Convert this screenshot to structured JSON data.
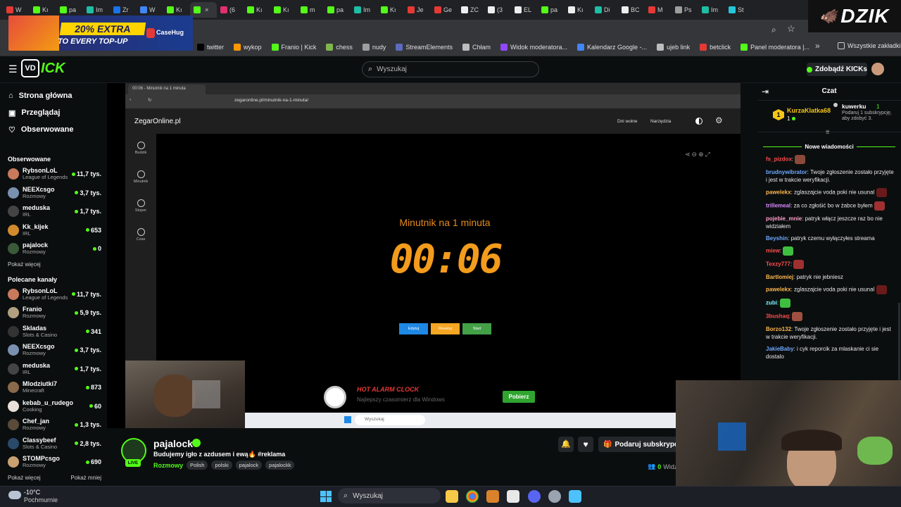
{
  "browser": {
    "tabs": [
      {
        "label": "W",
        "color": "#e53935"
      },
      {
        "label": "Kı",
        "color": "#53fc18"
      },
      {
        "label": "pa",
        "color": "#53fc18"
      },
      {
        "label": "Im",
        "color": "#1ebea5"
      },
      {
        "label": "Zr",
        "color": "#1a73e8"
      },
      {
        "label": "W",
        "color": "#4285f4"
      },
      {
        "label": "Kı",
        "color": "#53fc18"
      },
      {
        "label": "",
        "color": "#53fc18",
        "active": true
      },
      {
        "label": "(6",
        "color": "#e1306c"
      },
      {
        "label": "Kı",
        "color": "#53fc18"
      },
      {
        "label": "Kı",
        "color": "#53fc18"
      },
      {
        "label": "m",
        "color": "#53fc18"
      },
      {
        "label": "pa",
        "color": "#53fc18"
      },
      {
        "label": "Im",
        "color": "#1ebea5"
      },
      {
        "label": "Kı",
        "color": "#53fc18"
      },
      {
        "label": "Je",
        "color": "#e53935"
      },
      {
        "label": "Ge",
        "color": "#e53935"
      },
      {
        "label": "ZC",
        "color": "#eeeeee"
      },
      {
        "label": "(3",
        "color": "#eeeeee"
      },
      {
        "label": "EL",
        "color": "#eeeeee"
      },
      {
        "label": "pa",
        "color": "#53fc18"
      },
      {
        "label": "Kı",
        "color": "#eeeeee"
      },
      {
        "label": "Di",
        "color": "#1ebea5"
      },
      {
        "label": "BC",
        "color": "#eeeeee"
      },
      {
        "label": "M",
        "color": "#e53935"
      },
      {
        "label": "Ps",
        "color": "#9e9e9e"
      },
      {
        "label": "Im",
        "color": "#1ebea5"
      },
      {
        "label": "St",
        "color": "#26c6da"
      }
    ],
    "bookmarks": [
      {
        "label": "twitter",
        "color": "#000000"
      },
      {
        "label": "wykop",
        "color": "#ff9800"
      },
      {
        "label": "Franio | Kick",
        "color": "#53fc18"
      },
      {
        "label": "chess",
        "color": "#81b64c"
      },
      {
        "label": "nudy",
        "color": "#9e9e9e"
      },
      {
        "label": "StreamElements",
        "color": "#5c6bc0"
      },
      {
        "label": "Chłam",
        "color": "#bdbdbd"
      },
      {
        "label": "Widok moderatora...",
        "color": "#9147ff"
      },
      {
        "label": "Kalendarz Google -...",
        "color": "#4285f4"
      },
      {
        "label": "ujeb link",
        "color": "#bdbdbd"
      },
      {
        "label": "betclick",
        "color": "#e53935"
      },
      {
        "label": "Panel moderatora |...",
        "color": "#53fc18"
      }
    ],
    "all_bookmarks": "Wszystkie zakładki"
  },
  "ad": {
    "promo": "20% EXTRA",
    "sub": "TO EVERY TOP-UP",
    "brand": "CaseHug"
  },
  "overlay_logo": "DZIK",
  "kick": {
    "search_placeholder": "Wyszukaj",
    "kicks_button": "Zdobądź KICKs",
    "nav": [
      "Strona główna",
      "Przeglądaj",
      "Obserwowane"
    ],
    "followed_title": "Obserwowane",
    "followed": [
      {
        "name": "RybsonLoL",
        "category": "League of Legends",
        "viewers": "11,7 tys.",
        "color": "#c97a5c"
      },
      {
        "name": "NEEXcsgo",
        "category": "Rozmowy",
        "viewers": "3,7 tys.",
        "color": "#7a90b0"
      },
      {
        "name": "meduska",
        "category": "IRL",
        "viewers": "1,7 tys.",
        "color": "#444"
      },
      {
        "name": "Kk_kijek",
        "category": "IRL",
        "viewers": "653",
        "color": "#d18b2c"
      },
      {
        "name": "pajalock",
        "category": "Rozmowy",
        "viewers": "0",
        "color": "#3a5a3a"
      }
    ],
    "show_more": "Pokaż więcej",
    "recommended_title": "Polecane kanały",
    "recommended": [
      {
        "name": "RybsonLoL",
        "category": "League of Legends",
        "viewers": "11,7 tys.",
        "color": "#c97a5c"
      },
      {
        "name": "Franio",
        "category": "Rozmowy",
        "viewers": "5,9 tys.",
        "color": "#b0a080"
      },
      {
        "name": "Skladas",
        "category": "Slots & Casino",
        "viewers": "341",
        "color": "#333"
      },
      {
        "name": "NEEXcsgo",
        "category": "Rozmowy",
        "viewers": "3,7 tys.",
        "color": "#7a90b0"
      },
      {
        "name": "meduska",
        "category": "IRL",
        "viewers": "1,7 tys.",
        "color": "#444"
      },
      {
        "name": "Mlodziutki7",
        "category": "Minecraft",
        "viewers": "873",
        "color": "#8a6a4a"
      },
      {
        "name": "kebab_u_rudego",
        "category": "Cooking",
        "viewers": "60",
        "color": "#e8e0d8"
      },
      {
        "name": "Chef_jan",
        "category": "Rozmowy",
        "viewers": "1,3 tys.",
        "color": "#5a4a3a"
      },
      {
        "name": "Classybeef",
        "category": "Slots & Casino",
        "viewers": "2,8 tys.",
        "color": "#2a4a6a"
      },
      {
        "name": "STOMPcsgo",
        "category": "Rozmowy",
        "viewers": "690",
        "color": "#c9a070"
      }
    ],
    "show_more2": "Pokaż więcej",
    "show_less": "Pokaż mniej"
  },
  "inner": {
    "tab_title": "00:06 - Minutnik na 1 minuta",
    "url": "zegaronline.pl/minutnik-na-1-minuta/",
    "site_name": "ZegarOnline.pl",
    "menu": [
      "Dni wolne",
      "Narzędzia"
    ],
    "side": [
      "Budzik",
      "Minutnik",
      "Stoper",
      "Czas"
    ],
    "clock_title": "Minutnik na 1 minuta",
    "clock_time": "00:06",
    "buttons": [
      {
        "label": "Edytuj",
        "color": "#1e88e5"
      },
      {
        "label": "Resetuj",
        "color": "#f5a623"
      },
      {
        "label": "Start",
        "color": "#43a047"
      }
    ],
    "ad_title": "HOT ALARM CLOCK",
    "ad_sub": "Najlepszy czasomierz dla Windows",
    "ad_button": "Pobierz",
    "taskbar_search": "Wyszukaj"
  },
  "streamer": {
    "name": "pajalock",
    "title": "Budujemy igło z azdusem i ewą🔥 #reklama",
    "category": "Rozmowy",
    "tags": [
      "Polish",
      "polski",
      "pajalock",
      "pajalockk"
    ],
    "live": "LIVE",
    "subscribe": "Podaruj subskrypcję",
    "viewers": "0",
    "viewers_label": "Widz"
  },
  "chat": {
    "title": "Czat",
    "pinned_user": "KurzaKlatka68",
    "pinned_count": "1",
    "pinned_rank": "1",
    "gift_user": "kuwerku",
    "gift_count": "1",
    "gift_text": "Podaruj 1 subskrypcję, aby zdobyć 3.",
    "new_messages": "Nowe wiadomości",
    "messages": [
      {
        "user": "fs_pizdox",
        "color": "#ff4d4d",
        "text": "",
        "emote": "#8a4a3a"
      },
      {
        "user": "brudnywibrator",
        "color": "#6fa8ff",
        "text": "Twoje zgłoszenie zostało przyjęte i jest w trakcie weryfikacji.",
        "emote": ""
      },
      {
        "user": "pawelekx",
        "color": "#ffb84d",
        "text": "zglaszajcie voda  poki nie usunal",
        "emote": "#6a1a1a"
      },
      {
        "user": "trillemeal",
        "color": "#d98bff",
        "text": "za co zgłośić bo w żabce byłem",
        "emote": "#a03030"
      },
      {
        "user": "pojebie_mnie",
        "color": "#ff9ecb",
        "text": "patryk włącz jeszcze raz bo nie widziałem",
        "emote": ""
      },
      {
        "user": "Beyshin",
        "color": "#6fa8ff",
        "text": "patryk czemu wyłączyłes streama",
        "emote": ""
      },
      {
        "user": "miew",
        "color": "#ff4d4d",
        "text": "",
        "emote": "#3fbf3f"
      },
      {
        "user": "Texzy777",
        "color": "#ff4d4d",
        "text": "",
        "emote": "#a03030"
      },
      {
        "user": "Bartlomiej",
        "color": "#ffb84d",
        "text": "patryk nie jebniesz",
        "emote": ""
      },
      {
        "user": "pawelekx",
        "color": "#ffb84d",
        "text": "zglaszajcie voda  poki nie usunal",
        "emote": "#6a1a1a"
      },
      {
        "user": "zubi",
        "color": "#7df9ff",
        "text": "",
        "emote": "#3fbf3f"
      },
      {
        "user": "3bushaq",
        "color": "#ff4d4d",
        "text": "",
        "emote": "#a05040"
      },
      {
        "user": "Borzo132",
        "color": "#ffb84d",
        "text": "Twoje zgłoszenie zostało przyjęte i jest w trakcie weryfikacji.",
        "emote": ""
      },
      {
        "user": "JakieBaby",
        "color": "#6fa8ff",
        "text": "i cyk reporcik za mlaskanie ci sie dostalo",
        "emote": ""
      }
    ]
  },
  "windows": {
    "weather_temp": "-10°C",
    "weather_desc": "Pochmurnie",
    "search": "Wyszukaj"
  }
}
